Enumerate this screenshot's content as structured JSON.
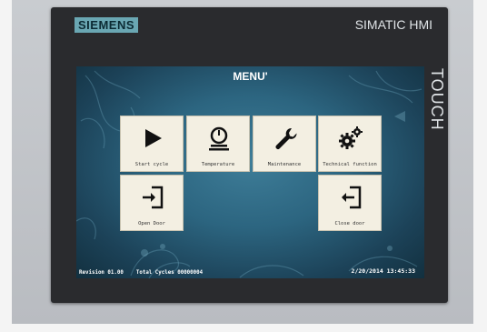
{
  "device": {
    "brand": "SIEMENS",
    "model": "SIMATIC HMI",
    "side_label": "TOUCH"
  },
  "screen": {
    "title": "MENU'",
    "buttons": [
      {
        "label": "Start cycle",
        "icon": "play-icon"
      },
      {
        "label": "Temperature",
        "icon": "gauge-icon"
      },
      {
        "label": "Maintenance",
        "icon": "wrench-icon"
      },
      {
        "label": "Technical function",
        "icon": "gears-icon"
      },
      {
        "label": "Open Door",
        "icon": "enter-door-icon"
      },
      {
        "label": "Close door",
        "icon": "enter-door-icon"
      }
    ],
    "footer": {
      "revision": "Revision 01.00",
      "total_cycles": "Total Cycles 00000004",
      "datetime": "2/20/2014 13:45:33"
    }
  },
  "colors": {
    "bezel": "#2a2b2e",
    "brand_bg": "#6aa7b3",
    "screen_bg": "#2c6580",
    "button_bg": "#f3efe2"
  }
}
